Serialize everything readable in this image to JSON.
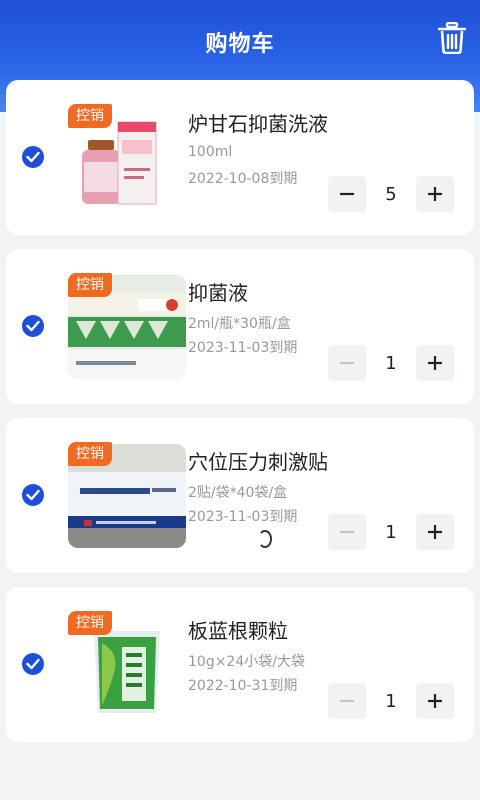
{
  "header": {
    "title": "购物车",
    "delete_icon": "trash-icon"
  },
  "accent_color": "#1f4fd6",
  "badge_color": "#f06a22",
  "items": [
    {
      "badge": "控销",
      "name": "炉甘石抑菌洗液",
      "spec": "100ml",
      "expiry": "2022-10-08到期",
      "quantity": "5",
      "checked": true,
      "minus_enabled": true
    },
    {
      "badge": "控销",
      "name": "抑菌液",
      "spec": "2ml/瓶*30瓶/盒",
      "expiry": "2023-11-03到期",
      "quantity": "1",
      "checked": true,
      "minus_enabled": false
    },
    {
      "badge": "控销",
      "name": "穴位压力刺激贴",
      "spec": "2贴/袋*40袋/盒",
      "expiry": "2023-11-03到期",
      "quantity": "1",
      "checked": true,
      "minus_enabled": false
    },
    {
      "badge": "控销",
      "name": "板蓝根颗粒",
      "spec": "10g×24小袋/大袋",
      "expiry": "2022-10-31到期",
      "quantity": "1",
      "checked": true,
      "minus_enabled": false
    }
  ]
}
